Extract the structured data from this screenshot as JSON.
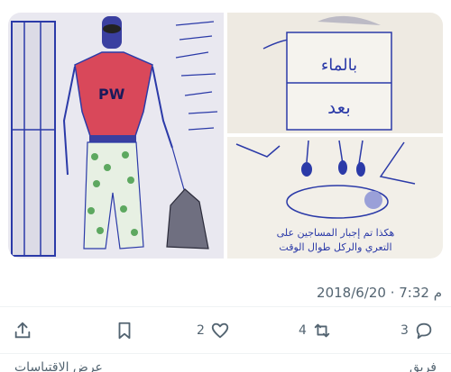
{
  "tweet": {
    "images": [
      {
        "name": "drawing-prison-guard-with-dog"
      },
      {
        "name": "drawing-water-containers"
      },
      {
        "name": "drawing-prisoner-beneath-guards"
      }
    ],
    "image_2_text": {
      "line1": "بالماء",
      "line2": "بعد"
    },
    "image_3_text": {
      "line1": "هكذا تم إجبار المساجين على",
      "line2": "التعري والركل طوال الوقت"
    },
    "timestamp": "2018/6/20 · 7:32 م",
    "actions": {
      "reply_count": "3",
      "retweet_count": "4",
      "like_count": "2"
    }
  },
  "bottom_bar": {
    "right_text": "فريق",
    "left_text": "عرض الاقتباسات"
  },
  "colors": {
    "ink": "#2b3aa8",
    "accent": "#536471",
    "red_shirt": "#d9485a",
    "green": "#5da860"
  }
}
